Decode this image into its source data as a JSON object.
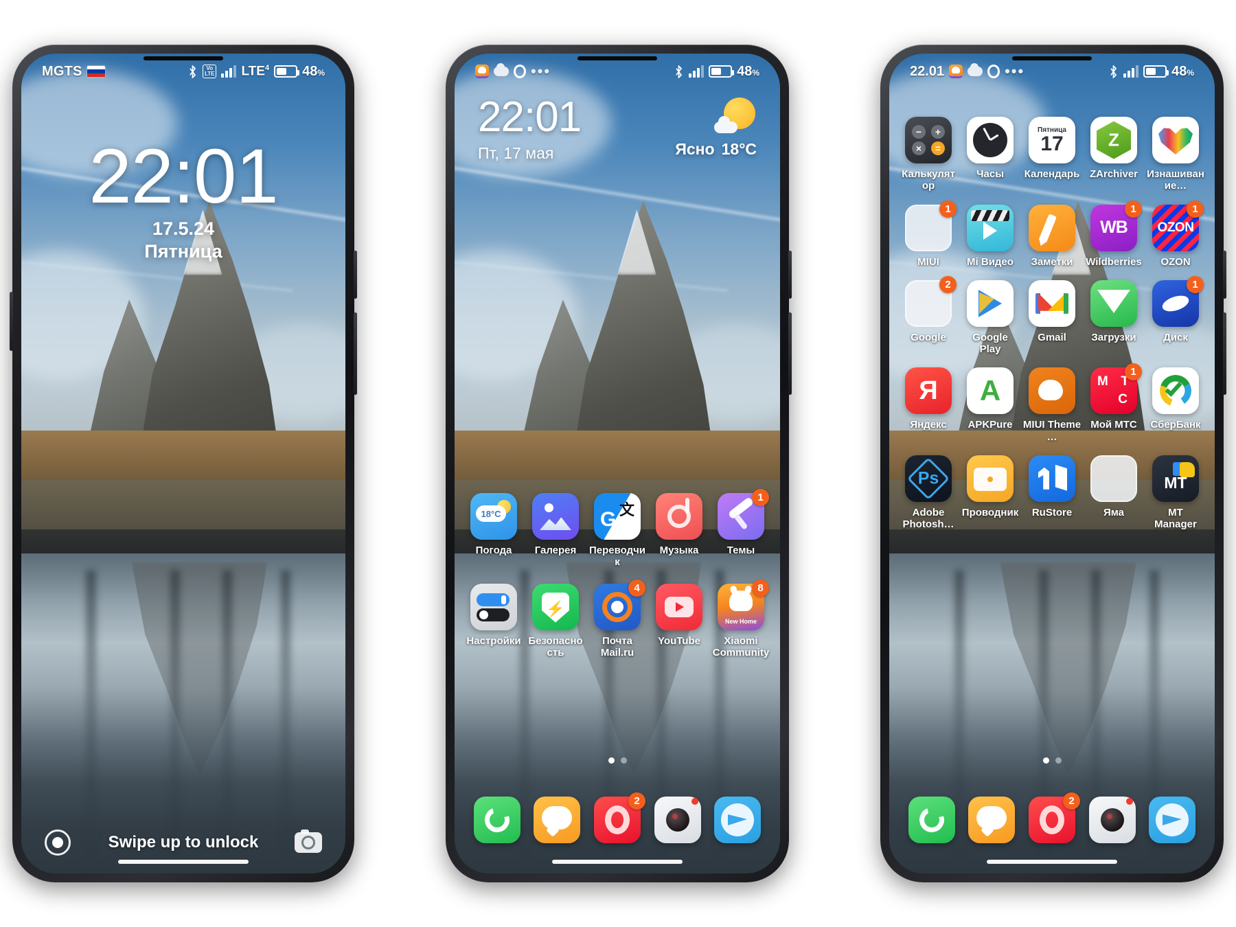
{
  "phones": {
    "lock": {
      "statusbar": {
        "carrier": "MGTS",
        "flag": "ru-flag-icon",
        "bluetooth": "bluetooth-icon",
        "volte": "VoLTE",
        "volte_top": "Vo",
        "volte_bottom": "LTE",
        "network": "LTE",
        "network_sup": "4",
        "battery_pct": "48",
        "battery_unit": "%"
      },
      "clock": {
        "time": "22:01",
        "date": "17.5.24",
        "weekday": "Пятница"
      },
      "hint": "Swipe up to unlock",
      "left_button": "assistant-button",
      "right_button": "camera-button"
    },
    "home": {
      "statusbar": {
        "notif_icons": [
          "xiaomi-community-icon",
          "cloud-icon",
          "opera-icon",
          "more-dots-icon"
        ],
        "bluetooth": "bluetooth-icon",
        "battery_pct": "48",
        "battery_unit": "%"
      },
      "widget": {
        "time": "22:01",
        "date": "Пт, 17 мая",
        "weather_condition": "Ясно",
        "weather_temp": "18°C",
        "weather_icon": "partly-sunny-icon"
      },
      "rows": [
        [
          {
            "label": "Погода",
            "icon": "weather-app-icon",
            "badge": "",
            "temp": "18°C"
          },
          {
            "label": "Галерея",
            "icon": "gallery-app-icon",
            "badge": ""
          },
          {
            "label": "Переводчик",
            "icon": "translate-app-icon",
            "badge": ""
          },
          {
            "label": "Музыка",
            "icon": "music-app-icon",
            "badge": ""
          },
          {
            "label": "Темы",
            "icon": "themes-app-icon",
            "badge": "1"
          }
        ],
        [
          {
            "label": "Настройки",
            "icon": "settings-app-icon",
            "badge": ""
          },
          {
            "label": "Безопасность",
            "icon": "security-app-icon",
            "badge": ""
          },
          {
            "label": "Почта Mail.ru",
            "icon": "mailru-app-icon",
            "badge": "4"
          },
          {
            "label": "YouTube",
            "icon": "youtube-app-icon",
            "badge": ""
          },
          {
            "label": "Xiaomi Community",
            "icon": "xiaomi-community-app-icon",
            "badge": "8",
            "sub": "New Home"
          }
        ]
      ],
      "pager": {
        "pages": 2,
        "active": 0
      },
      "dock": [
        {
          "label": "Phone",
          "icon": "phone-app-icon",
          "badge": ""
        },
        {
          "label": "Messages",
          "icon": "messages-app-icon",
          "badge": ""
        },
        {
          "label": "Opera",
          "icon": "opera-app-icon",
          "badge": "2"
        },
        {
          "label": "Camera",
          "icon": "camera-app-icon",
          "badge": "dot"
        },
        {
          "label": "Telegram",
          "icon": "telegram-app-icon",
          "badge": ""
        }
      ]
    },
    "apps": {
      "statusbar": {
        "time": "22.01",
        "notif_icons": [
          "xiaomi-community-icon",
          "cloud-icon",
          "opera-icon",
          "more-dots-icon"
        ],
        "bluetooth": "bluetooth-icon",
        "battery_pct": "48",
        "battery_unit": "%"
      },
      "rows": [
        [
          {
            "label": "Калькулятор",
            "icon": "calculator-app-icon",
            "badge": ""
          },
          {
            "label": "Часы",
            "icon": "clock-app-icon",
            "badge": ""
          },
          {
            "label": "Календарь",
            "icon": "calendar-app-icon",
            "badge": "",
            "cal_weekday": "Пятница",
            "cal_day": "17"
          },
          {
            "label": "ZArchiver",
            "icon": "zarchiver-app-icon",
            "badge": "",
            "glyph": "Z"
          },
          {
            "label": "Изнашивание…",
            "icon": "wear-app-icon",
            "badge": ""
          }
        ],
        [
          {
            "label": "MIUI",
            "icon": "miui-folder-icon",
            "badge": "1"
          },
          {
            "label": "Mi Видео",
            "icon": "mi-video-app-icon",
            "badge": ""
          },
          {
            "label": "Заметки",
            "icon": "notes-app-icon",
            "badge": ""
          },
          {
            "label": "Wildberries",
            "icon": "wildberries-app-icon",
            "badge": "1",
            "glyph": "WB"
          },
          {
            "label": "OZON",
            "icon": "ozon-app-icon",
            "badge": "1",
            "glyph": "OZON"
          }
        ],
        [
          {
            "label": "Google",
            "icon": "google-folder-icon",
            "badge": "2"
          },
          {
            "label": "Google Play",
            "icon": "google-play-app-icon",
            "badge": ""
          },
          {
            "label": "Gmail",
            "icon": "gmail-app-icon",
            "badge": ""
          },
          {
            "label": "Загрузки",
            "icon": "downloads-app-icon",
            "badge": ""
          },
          {
            "label": "Диск",
            "icon": "disk-app-icon",
            "badge": "1"
          }
        ],
        [
          {
            "label": "Яндекс",
            "icon": "yandex-app-icon",
            "badge": "",
            "glyph": "Я"
          },
          {
            "label": "APKPure",
            "icon": "apkpure-app-icon",
            "badge": "",
            "glyph": "A"
          },
          {
            "label": "MIUI Theme …",
            "icon": "miui-theme-editor-app-icon",
            "badge": ""
          },
          {
            "label": "Мой МТС",
            "icon": "mts-app-icon",
            "badge": "1",
            "g1": "М",
            "g2": "Т",
            "g3": "С"
          },
          {
            "label": "СберБанк",
            "icon": "sberbank-app-icon",
            "badge": ""
          }
        ],
        [
          {
            "label": "Adobe Photosh…",
            "icon": "adobe-photoshop-app-icon",
            "badge": "",
            "glyph": "Ps"
          },
          {
            "label": "Проводник",
            "icon": "file-explorer-app-icon",
            "badge": ""
          },
          {
            "label": "RuStore",
            "icon": "rustore-app-icon",
            "badge": ""
          },
          {
            "label": "Яма",
            "icon": "yama-folder-icon",
            "badge": ""
          },
          {
            "label": "MT Manager",
            "icon": "mt-manager-app-icon",
            "badge": "",
            "glyph": "MT"
          }
        ]
      ],
      "pager": {
        "pages": 2,
        "active": 0
      },
      "dock": [
        {
          "label": "Phone",
          "icon": "phone-app-icon",
          "badge": ""
        },
        {
          "label": "Messages",
          "icon": "messages-app-icon",
          "badge": ""
        },
        {
          "label": "Opera",
          "icon": "opera-app-icon",
          "badge": "2"
        },
        {
          "label": "Camera",
          "icon": "camera-app-icon",
          "badge": "dot"
        },
        {
          "label": "Telegram",
          "icon": "telegram-app-icon",
          "badge": ""
        }
      ]
    }
  },
  "colors": {
    "badge": "#f4601c",
    "accent": "#2f8ef0",
    "status_text": "#ffffff"
  }
}
